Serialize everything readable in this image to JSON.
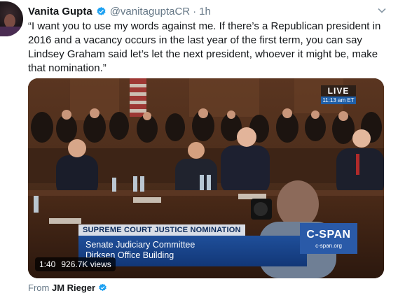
{
  "tweet": {
    "author_name": "Vanita Gupta",
    "handle": "@vanitaguptaCR",
    "separator": "·",
    "time": "1h",
    "text": "“I want you to use my words against me. If there’s a Republican president in 2016 and a vacancy occurs in the last year of the first term, you can say Lindsey Graham said let’s let the next president, whoever it might be, make that nomination.”"
  },
  "video": {
    "live_label": "LIVE",
    "live_time": "11:13 am ET",
    "lower_third": {
      "headline": "SUPREME COURT JUSTICE NOMINATION",
      "line1": "Senate Judiciary Committee",
      "line2": "Dirksen Office Building"
    },
    "network_logo": "C-SPAN",
    "network_url": "c-span.org",
    "duration": "1:40",
    "views": "926.7K views"
  },
  "footer": {
    "from_label": "From",
    "source_name": "JM Rieger"
  },
  "colors": {
    "verified_blue": "#1da1f2",
    "secondary_text": "#657786",
    "cspan_blue": "#2a5aa8"
  },
  "icons": {
    "verified": "verified-badge-icon",
    "caret": "chevron-down-icon"
  }
}
